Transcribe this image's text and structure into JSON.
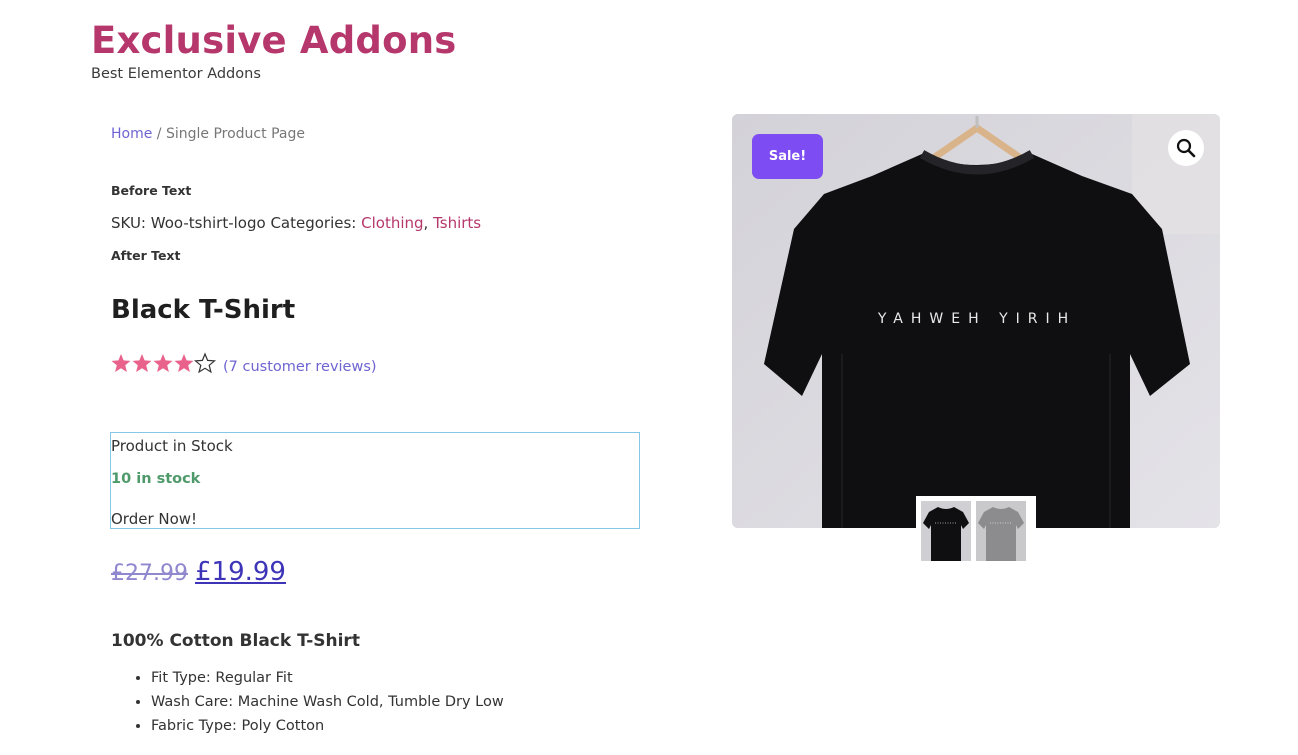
{
  "site": {
    "title": "Exclusive Addons",
    "tagline": "Best Elementor Addons"
  },
  "breadcrumb": {
    "home": "Home",
    "separator": " / ",
    "current": "Single Product Page"
  },
  "product": {
    "before_text": "Before Text",
    "sku_label": "SKU:",
    "sku": "Woo-tshirt-logo",
    "categories_label": "Categories:",
    "categories": [
      "Clothing",
      "Tshirts"
    ],
    "after_text": "After Text",
    "title": "Black T-Shirt",
    "rating": 4.5,
    "rating_max": 5,
    "review_link": "(7 customer reviews)",
    "stock": {
      "heading": "Product in Stock",
      "count": "10 in stock",
      "order": "Order Now!"
    },
    "price": {
      "old": "£27.99",
      "new": "£19.99"
    },
    "description_title": "100% Cotton Black T-Shirt",
    "features": [
      "Fit Type: Regular Fit",
      "Wash Care: Machine Wash Cold, Tumble Dry Low",
      "Fabric Type: Poly Cotton"
    ]
  },
  "gallery": {
    "sale_badge": "Sale!",
    "shirt_print": "YAHWEH YIRIH",
    "thumbnails": [
      "black-tshirt-thumbnail",
      "grey-tshirt-thumbnail"
    ]
  },
  "colors": {
    "brand": "#b6376b",
    "link": "#6e64d1",
    "sale": "#7d4cf2",
    "stock": "#4f9a6b",
    "star": "#e8628b"
  }
}
